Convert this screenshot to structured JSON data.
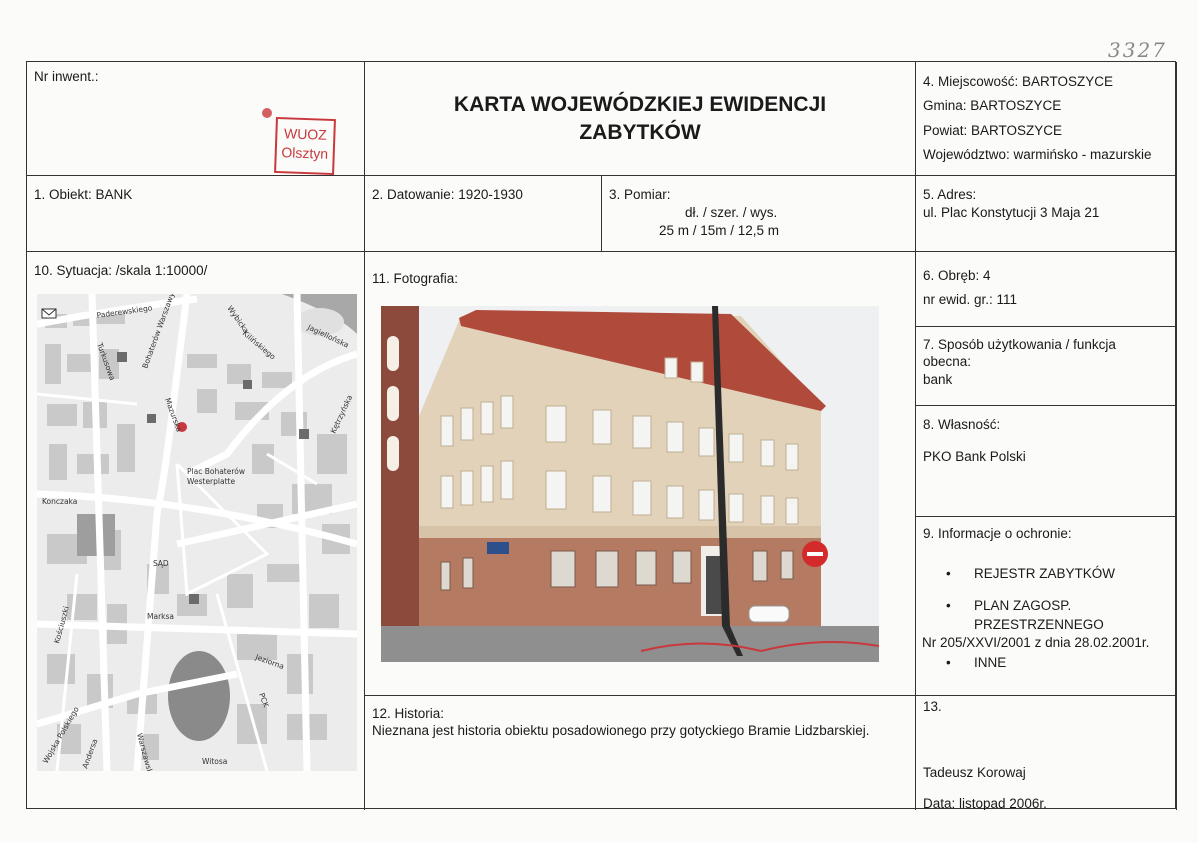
{
  "sheet_number": "3327",
  "stamp": {
    "line1": "WUOZ",
    "line2": "Olsztyn"
  },
  "inventory": {
    "label": "Nr inwent.:"
  },
  "header": {
    "title_line1": "KARTA WOJEWÓDZKIEJ EWIDENCJI",
    "title_line2": "ZABYTKÓW"
  },
  "location": {
    "miejscowosc": "4. Miejscowość: BARTOSZYCE",
    "gmina": "Gmina: BARTOSZYCE",
    "powiat": "Powiat: BARTOSZYCE",
    "wojewodztwo": "Województwo: warmińsko - mazurskie"
  },
  "object": {
    "label": "1. Obiekt: BANK"
  },
  "dating": {
    "label": "2. Datowanie: 1920-1930"
  },
  "measurement": {
    "label": "3. Pomiar:",
    "dims_label": "dł. / szer. / wys.",
    "dims_value": "25 m / 15m / 12,5 m"
  },
  "address": {
    "label": "5. Adres:",
    "value": "ul. Plac Konstytucji 3 Maja 21"
  },
  "situation": {
    "label": "10. Sytuacja: /skala 1:10000/",
    "map_labels": {
      "plac_line1": "Plac Bohaterów",
      "plac_line2": "Westerplatte",
      "paderewskiego": "Paderewskiego",
      "wyborca": "Wybicka",
      "turkusowa": "Turkusowa",
      "kilinskiego": "Kilińskiego",
      "jagiellonska": "Jagiellońska",
      "mazurska": "Mazurska",
      "bohaterow_warszawy": "Bohaterów Warszawy",
      "konczaka": "Konczaka",
      "marksa": "Marksa",
      "jeziorna": "Jeziorna",
      "witosa": "Witosa",
      "wojska_polskiego": "Wojska Polskiego",
      "andersa": "Andersa",
      "ketrzynska": "Kętrzyńska",
      "sad": "SĄD",
      "pck": "PCK",
      "warszawska": "Warszawska",
      "kosciuszki": "Kościuszki"
    }
  },
  "photo": {
    "label": "11. Fotografia:"
  },
  "district": {
    "label": "6. Obręb: 4",
    "plot": "nr ewid. gr.: 111"
  },
  "usage": {
    "line1": "7. Sposób użytkowania / funkcja",
    "line2": "obecna:",
    "value": "bank"
  },
  "ownership": {
    "label": "8. Własność:",
    "value": "PKO Bank Polski"
  },
  "protection": {
    "label": "9. Informacje o ochronie:",
    "item1": "REJESTR ZABYTKÓW",
    "item2_line1": "PLAN ZAGOSP.",
    "item2_line2": "PRZESTRZENNEGO",
    "plan_nr": "Nr 205/XXVI/2001 z dnia 28.02.2001r.",
    "item3": "INNE"
  },
  "history": {
    "label": "12. Historia:",
    "text": "Nieznana jest historia obiektu posadowionego przy gotyckiego Bramie Lidzbarskiej."
  },
  "section13": {
    "label": "13.",
    "author": "Tadeusz Korowaj",
    "date": "Data: listopad 2006r."
  },
  "colors": {
    "stamp": "#c9383c",
    "border": "#333333",
    "facade": "#e2d2ba",
    "roof": "#b04a3a",
    "base": "#b57a62"
  }
}
